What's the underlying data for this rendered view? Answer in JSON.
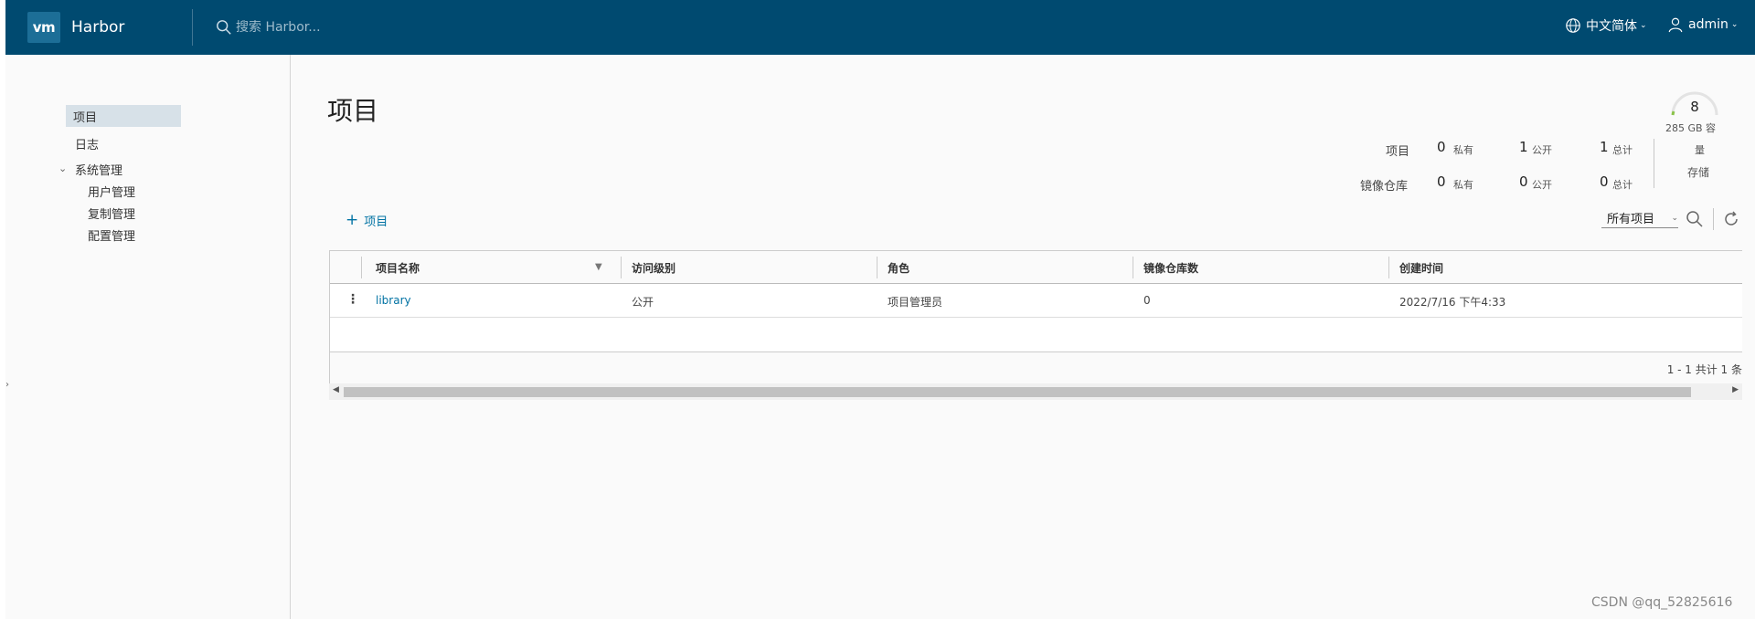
{
  "header": {
    "logo_text": "vm",
    "app_name": "Harbor",
    "search_placeholder": "搜索 Harbor...",
    "language": "中文简体",
    "user": "admin"
  },
  "sidebar": {
    "items": [
      {
        "label": "项目"
      },
      {
        "label": "日志"
      },
      {
        "label": "系统管理"
      },
      {
        "label": "用户管理"
      },
      {
        "label": "复制管理"
      },
      {
        "label": "配置管理"
      }
    ]
  },
  "page": {
    "title": "项目"
  },
  "summary": {
    "projects_label": "项目",
    "repos_label": "镜像仓库",
    "private_label": "私有",
    "public_label": "公开",
    "total_label": "总计",
    "projects": {
      "private": "0",
      "public": "1",
      "total": "1"
    },
    "repos": {
      "private": "0",
      "public": "0",
      "total": "0"
    },
    "storage": {
      "value": "8",
      "capacity_line1": "285 GB 容",
      "capacity_line2": "量",
      "label": "存储"
    }
  },
  "toolbar": {
    "add_label": "项目",
    "filter_value": "所有项目"
  },
  "table": {
    "columns": [
      "项目名称",
      "访问级别",
      "角色",
      "镜像仓库数",
      "创建时间"
    ],
    "rows": [
      {
        "name": "library",
        "access": "公开",
        "role": "项目管理员",
        "repo_count": "0",
        "created": "2022/7/16 下午4:33"
      }
    ],
    "pagination": "1 - 1 共计 1 条"
  },
  "watermark": "CSDN @qq_52825616",
  "colors": {
    "header_bg": "#004a70",
    "accent": "#0072a3"
  }
}
